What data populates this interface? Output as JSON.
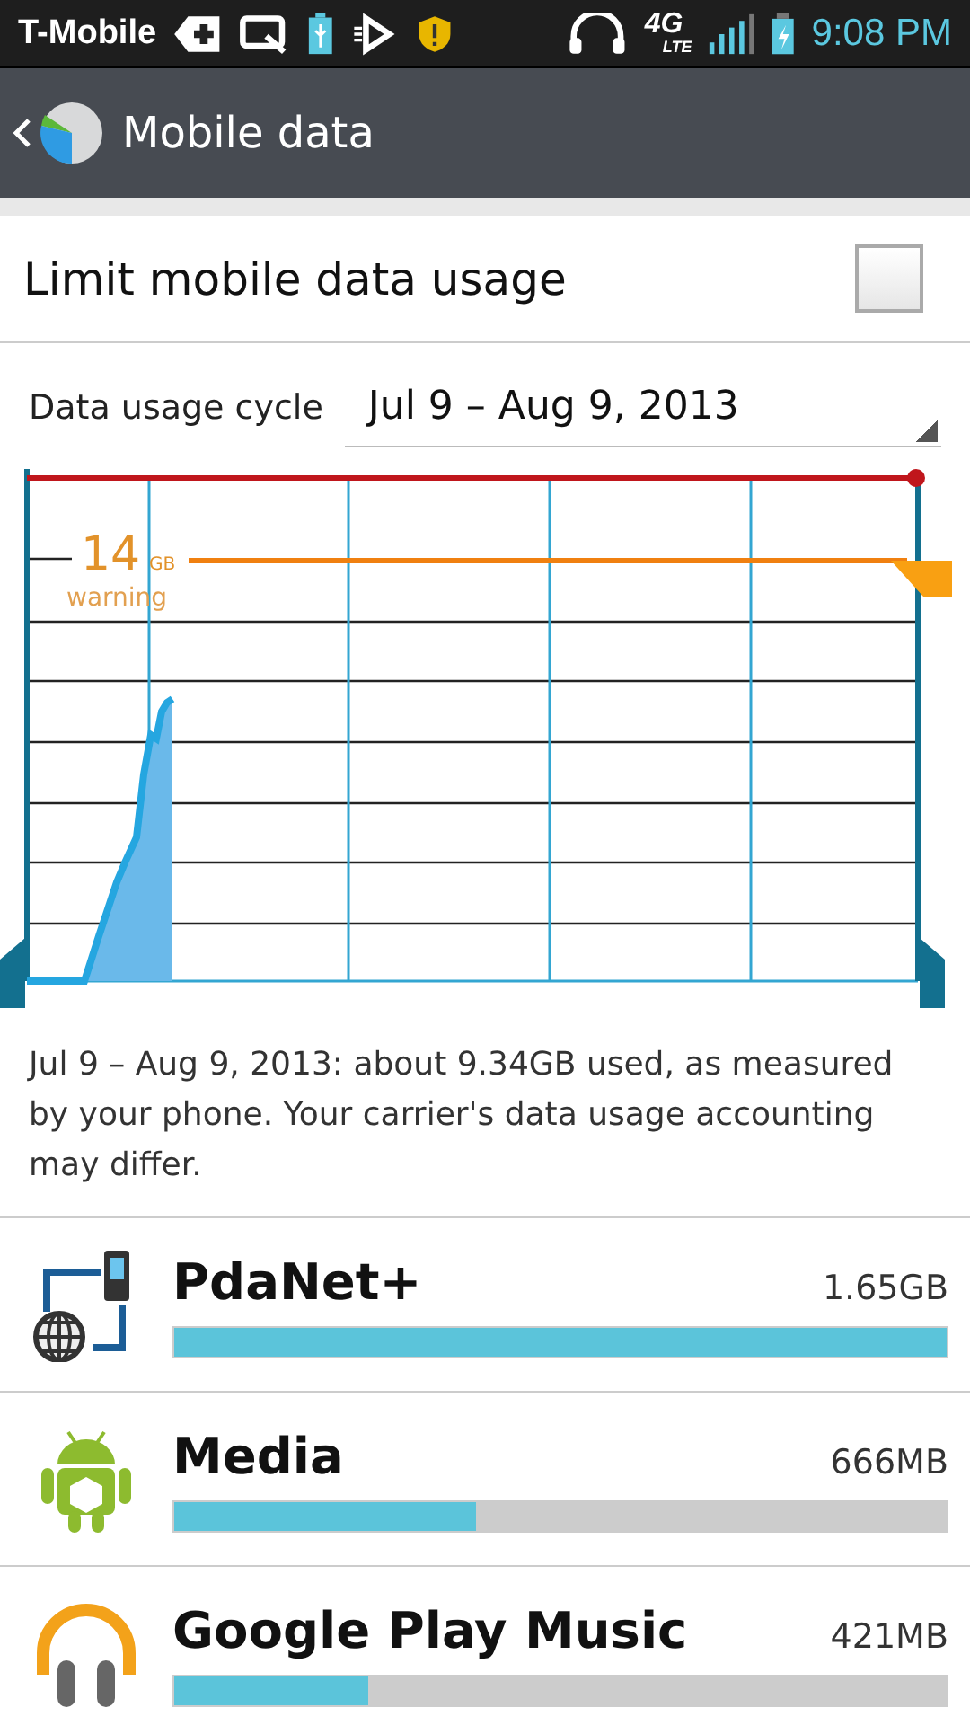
{
  "status_bar": {
    "carrier": "T-Mobile",
    "network": "4G",
    "network_sub": "LTE",
    "time": "9:08 PM"
  },
  "action_bar": {
    "title": "Mobile data"
  },
  "limit_setting": {
    "label": "Limit mobile data usage",
    "checked": false
  },
  "cycle": {
    "label": "Data usage cycle",
    "value": "Jul 9 – Aug 9, 2013"
  },
  "chart": {
    "warning_value": "14",
    "warning_unit": "GB",
    "warning_label": "warning"
  },
  "summary": "Jul 9 – Aug 9, 2013: about 9.34GB used, as measured by your phone. Your carrier's data usage accounting may differ.",
  "apps": [
    {
      "name": "PdaNet+",
      "usage": "1.65GB",
      "level": 1.0,
      "kind": "network"
    },
    {
      "name": "Media",
      "usage": "666MB",
      "level": 0.39,
      "kind": "android"
    },
    {
      "name": "Google Play Music",
      "usage": "421MB",
      "level": 0.25,
      "kind": "music"
    }
  ]
}
